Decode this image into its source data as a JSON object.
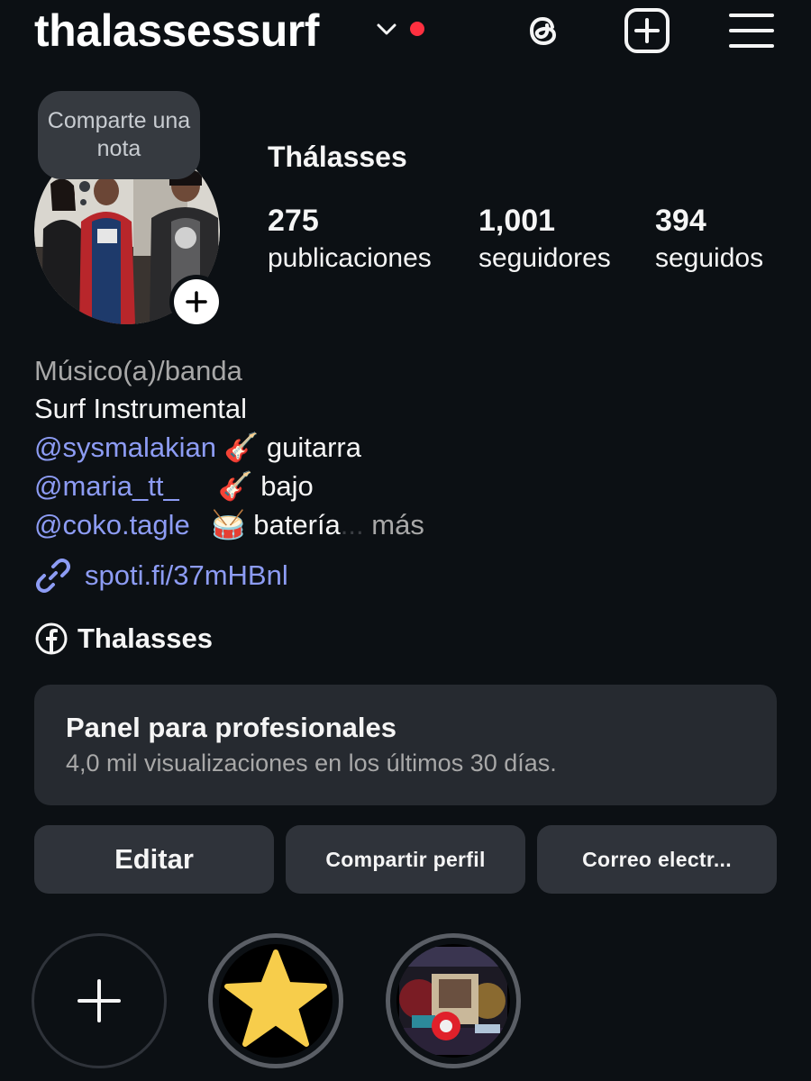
{
  "header": {
    "username": "thalassessurf",
    "icons": [
      "chevron-down-icon",
      "threads-icon",
      "create-icon",
      "menu-icon"
    ],
    "notification_dot_color": "#ff3040"
  },
  "note": {
    "text": "Comparte una nota"
  },
  "profile": {
    "display_name": "Thálasses",
    "stats": [
      {
        "value": "275",
        "label": "publicaciones"
      },
      {
        "value": "1,001",
        "label": "seguidores"
      },
      {
        "value": "394",
        "label": "seguidos"
      }
    ]
  },
  "bio": {
    "category": "Músico(a)/banda",
    "line1": "Surf Instrumental",
    "members": [
      {
        "handle": "@sysmalakian",
        "emoji": "🎸",
        "role": "guitarra"
      },
      {
        "handle": "@maria_tt_",
        "emoji": "🎸",
        "role": "bajo"
      },
      {
        "handle": "@coko.tagle",
        "emoji": "🥁",
        "role": "batería"
      }
    ],
    "ellipsis": "...",
    "more": "más",
    "link": "spoti.fi/37mHBnl",
    "facebook": "Thalasses"
  },
  "panel": {
    "title": "Panel para profesionales",
    "subtitle": "4,0 mil visualizaciones en los últimos 30 días."
  },
  "buttons": {
    "edit": "Editar",
    "share": "Compartir perfil",
    "email": "Correo electr..."
  },
  "colors": {
    "background": "#0c1014",
    "link": "#8d9cf4",
    "surface": "#2f333a"
  }
}
